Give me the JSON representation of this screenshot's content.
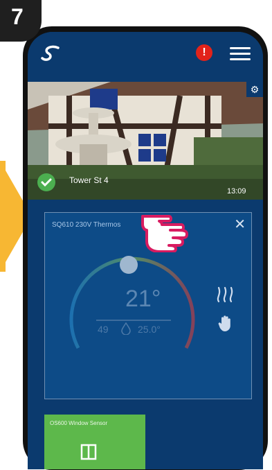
{
  "step": {
    "number": "7"
  },
  "header": {
    "alert": "!"
  },
  "location": {
    "name": "Tower St 4",
    "time": "13:09"
  },
  "tile": {
    "title": "SQ610 230V Thermos",
    "close": "✕",
    "temperature": "21°",
    "humidity": "49",
    "setpoint": "25.0°"
  },
  "sensor": {
    "label": "OS600 Window Sensor"
  },
  "colors": {
    "background": "#0b3a6e",
    "tile": "#0d4b87",
    "accent_arrow": "#f7b733",
    "alert": "#e2231a",
    "ok": "#4caf50",
    "sensor_tile": "#5db84b",
    "highlight_hand": "#d81b60"
  },
  "icons": {
    "logo": "salus-logo-icon",
    "alert": "alert-icon",
    "menu": "hamburger-menu-icon",
    "settings": "gear-icon",
    "status": "check-icon",
    "heating": "heat-waves-icon",
    "manual": "hand-icon",
    "humidity": "drop-icon",
    "window": "window-icon",
    "pointer": "pointing-hand-icon"
  }
}
